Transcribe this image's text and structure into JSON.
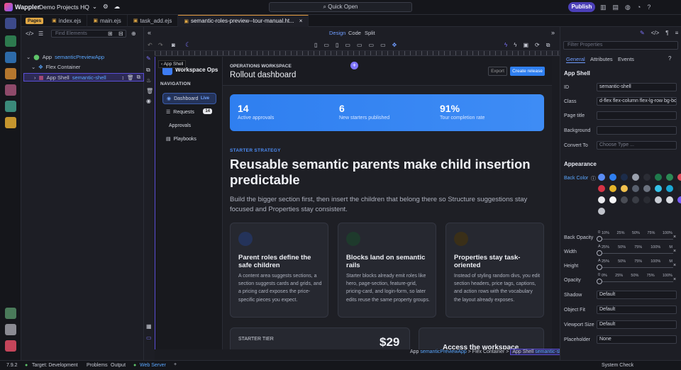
{
  "topbar": {
    "brand": "Wappler",
    "project": "Demo Projects HQ",
    "quick_open": "Quick Open",
    "publish": "Publish"
  },
  "tabs": {
    "badge": "Pages",
    "items": [
      {
        "label": "index.ejs"
      },
      {
        "label": "main.ejs"
      },
      {
        "label": "task_add.ejs"
      },
      {
        "label": "semantic-roles-preview--tour-manual.ht..."
      }
    ]
  },
  "structure": {
    "find_placeholder": "Find Elements",
    "tree": [
      {
        "label": "App",
        "name": "semanticPreviewApp"
      },
      {
        "label": "Flex Container",
        "name": ""
      },
      {
        "label": "App Shell",
        "name": "semantic-shell"
      }
    ]
  },
  "modes": {
    "design": "Design",
    "code": "Code",
    "split": "Split"
  },
  "preview": {
    "crumb_tooltip": "App Shell",
    "brand": "Workspace Ops",
    "nav_heading": "NAVIGATION",
    "nav": [
      {
        "label": "Dashboard",
        "badge": "Live"
      },
      {
        "label": "Requests",
        "badge": "14"
      },
      {
        "label": "Approvals",
        "badge": ""
      },
      {
        "label": "Playbooks",
        "badge": ""
      }
    ],
    "kicker": "OPERATIONS WORKSPACE",
    "title": "Rollout dashboard",
    "export_btn": "Export",
    "create_btn": "Create release",
    "stats": [
      {
        "value": "14",
        "label": "Active approvals"
      },
      {
        "value": "6",
        "label": "New starters published"
      },
      {
        "value": "91%",
        "label": "Tour completion rate"
      }
    ],
    "section_kicker": "STARTER STRATEGY",
    "headline": "Reusable semantic parents make child insertion predictable",
    "lead": "Build the bigger section first, then insert the children that belong there so Structure suggestions stay focused and Properties stay consistent.",
    "cards": [
      {
        "title": "Parent roles define the safe children",
        "desc": "A content area suggests sections, a section suggests cards and grids, and a pricing card exposes the price-specific pieces you expect.",
        "icon": "sitemap-icon",
        "color": "#3a5fb8"
      },
      {
        "title": "Blocks land on semantic rails",
        "desc": "Starter blocks already emit roles like hero, page-section, feature-grid, pricing-card, and login-form, so later edits reuse the same property groups.",
        "icon": "stack-icon",
        "color": "#2f8a55"
      },
      {
        "title": "Properties stay task-oriented",
        "desc": "Instead of styling random divs, you edit section headers, price tags, captions, and action rows with the vocabulary the layout already exposes.",
        "icon": "sliders-icon",
        "color": "#b98a2a"
      }
    ],
    "tier_label": "STARTER TIER",
    "tier_price": "$29",
    "access_title": "Access the workspace"
  },
  "breadcrumb": {
    "a": "App",
    "a_name": "semanticPreviewApp",
    "b": "Flex Container",
    "c": "App Shell",
    "c_name": "semantic-shell"
  },
  "props": {
    "filter_placeholder": "Filter Properties",
    "tabs": [
      "General",
      "Attributes",
      "Events"
    ],
    "section": "App Shell",
    "fields": [
      {
        "label": "ID",
        "value": "semantic-shell"
      },
      {
        "label": "Class",
        "value": "d-flex flex-column flex-lg-row bg-bo"
      },
      {
        "label": "Page title",
        "value": ""
      },
      {
        "label": "Background",
        "value": ""
      },
      {
        "label": "Convert To",
        "value": "Choose Type ..."
      }
    ],
    "appearance": "Appearance",
    "back_color": "Back Color",
    "sliders": [
      {
        "label": "Back Opacity",
        "prefix": "0",
        "ticks": [
          "10%",
          "25%",
          "50%",
          "75%",
          "100%"
        ]
      },
      {
        "label": "Width",
        "prefix": "A",
        "ticks": [
          "25%",
          "50%",
          "75%",
          "100%",
          "M"
        ]
      },
      {
        "label": "Height",
        "prefix": "A",
        "ticks": [
          "25%",
          "50%",
          "75%",
          "100%",
          "M"
        ]
      },
      {
        "label": "Opacity",
        "prefix": "0",
        "ticks": [
          "0%",
          "25%",
          "50%",
          "75%",
          "100%"
        ]
      }
    ],
    "selects": [
      {
        "label": "Shadow",
        "value": "Default"
      },
      {
        "label": "Object Fit",
        "value": "Default"
      },
      {
        "label": "Viewport Size",
        "value": "Default"
      },
      {
        "label": "Placeholder",
        "value": "None"
      }
    ],
    "swatches": [
      "#5b8df5",
      "#2f7ff0",
      "#1c2c4a",
      "#9aa0ad",
      "#2b2d35",
      "#1f7a4c",
      "#2b8a55",
      "#e04a5a",
      "#d63345",
      "#e5b42a",
      "#f2c14e",
      "#58606e",
      "#6c7380",
      "#35c2e8",
      "#1aa8d6",
      "#1f2228",
      "#e9eaee",
      "#f6f6f8",
      "#4a4d55",
      "#3a3d45",
      "#2a2c33",
      "#c8ccd4",
      "#dadde3",
      "#7a5cff",
      "#c0c3cb"
    ]
  },
  "status": {
    "version": "7.9.2",
    "target": "Target: Development",
    "problems": "Problems",
    "output": "Output",
    "web_server": "Web Server",
    "system_check": "System Check"
  }
}
